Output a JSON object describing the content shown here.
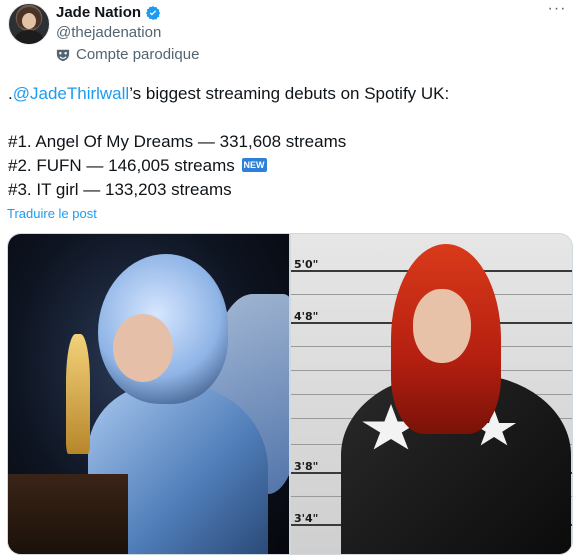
{
  "author": {
    "display_name": "Jade Nation",
    "handle": "@thejadenation",
    "label": "Compte parodique",
    "verified_color": "#1d9bf0"
  },
  "actions": {
    "more": "···"
  },
  "tweet": {
    "prefix": ".",
    "mention": "@JadeThirlwall",
    "line1_rest": "’s biggest streaming debuts on Spotify UK:",
    "items": [
      "#1. Angel Of My Dreams — 331,608 streams",
      "#2. FUFN — 146,005 streams",
      "#3. IT girl — 133,203 streams"
    ],
    "new_badge": "NEW",
    "translate": "Traduire le post"
  },
  "media": {
    "height_marks": [
      "5'0\"",
      "4'8\"",
      "3'8\"",
      "3'4\""
    ]
  },
  "colors": {
    "link": "#1d9bf0",
    "secondary_text": "#536471",
    "badge": "#2d7fd8"
  }
}
